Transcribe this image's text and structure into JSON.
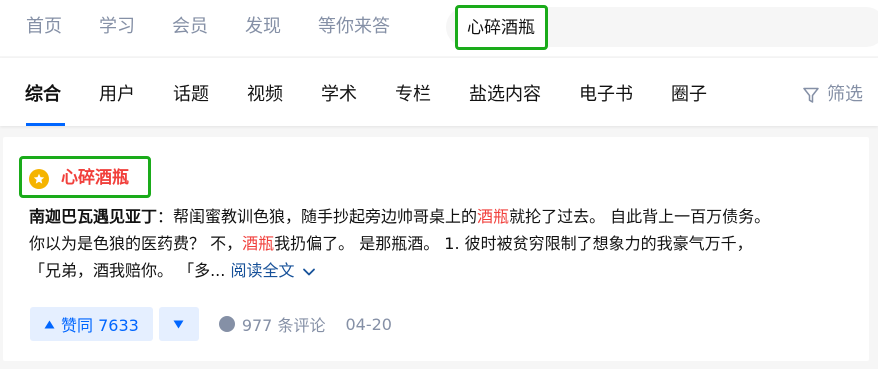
{
  "topnav": {
    "items": [
      {
        "label": "首页"
      },
      {
        "label": "学习"
      },
      {
        "label": "会员"
      },
      {
        "label": "发现"
      },
      {
        "label": "等你来答"
      }
    ]
  },
  "search": {
    "value": "心碎酒瓶"
  },
  "tabs": {
    "items": [
      {
        "label": "综合",
        "active": true
      },
      {
        "label": "用户"
      },
      {
        "label": "话题"
      },
      {
        "label": "视频"
      },
      {
        "label": "学术"
      },
      {
        "label": "专栏"
      },
      {
        "label": "盐选内容"
      },
      {
        "label": "电子书"
      },
      {
        "label": "圈子"
      }
    ],
    "filter_label": "筛选"
  },
  "result": {
    "title": "心碎酒瓶",
    "badge_icon": "star-icon",
    "author": "南迦巴瓦遇见亚丁",
    "separator": "：",
    "line1_a": "帮闺蜜教训色狼，随手抄起旁边帅哥桌上的",
    "line1_em": "酒瓶",
    "line1_b": "就抡了过去。 自此背上一百万债务。",
    "line2_a": "你以为是色狼的医药费？ 不，",
    "line2_em": "酒瓶",
    "line2_b": "我扔偏了。 是那瓶酒。 1. 彼时被贫穷限制了想象力的我豪气万千，",
    "line3": "「兄弟，酒我赔你。 「多...",
    "read_more": "阅读全文",
    "vote_up_label": "赞同 7633",
    "comment_count": "977 条评论",
    "date": "04-20"
  },
  "colors": {
    "accent": "#0066ff",
    "highlight_red": "#f1403c",
    "muted": "#8590a6",
    "annotation_green": "#1aab1a"
  }
}
